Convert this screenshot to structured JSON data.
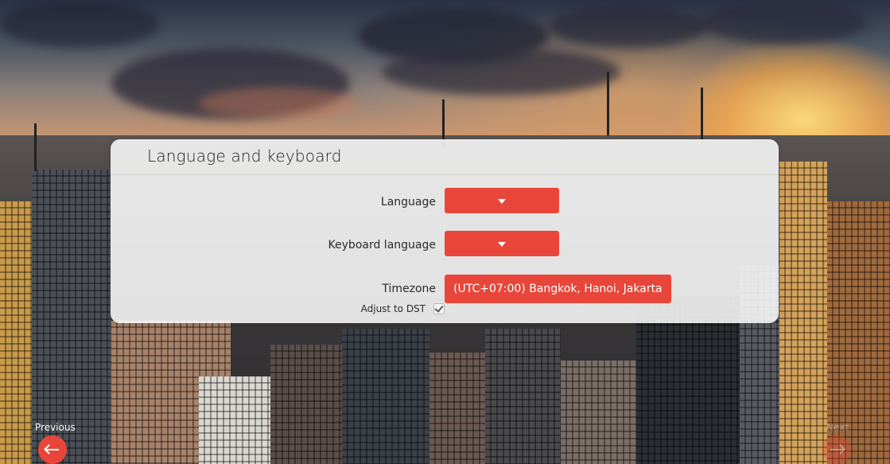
{
  "dialog": {
    "title": "Language and keyboard"
  },
  "fields": {
    "language": {
      "label": "Language",
      "value": ""
    },
    "keyboard_language": {
      "label": "Keyboard language",
      "value": ""
    },
    "timezone": {
      "label": "Timezone",
      "value": "(UTC+07:00) Bangkok, Hanoi, Jakarta"
    },
    "dst": {
      "label": "Adjust to DST",
      "checked": true
    }
  },
  "navigation": {
    "previous_label": "Previous",
    "next_label": "Next",
    "next_enabled": false
  },
  "colors": {
    "accent": "#e8463a",
    "panel_background": "#ffffff"
  },
  "icons": {
    "dropdown": "caret-down-icon",
    "previous": "arrow-left-icon",
    "next": "arrow-right-icon",
    "check": "checkmark-icon"
  }
}
